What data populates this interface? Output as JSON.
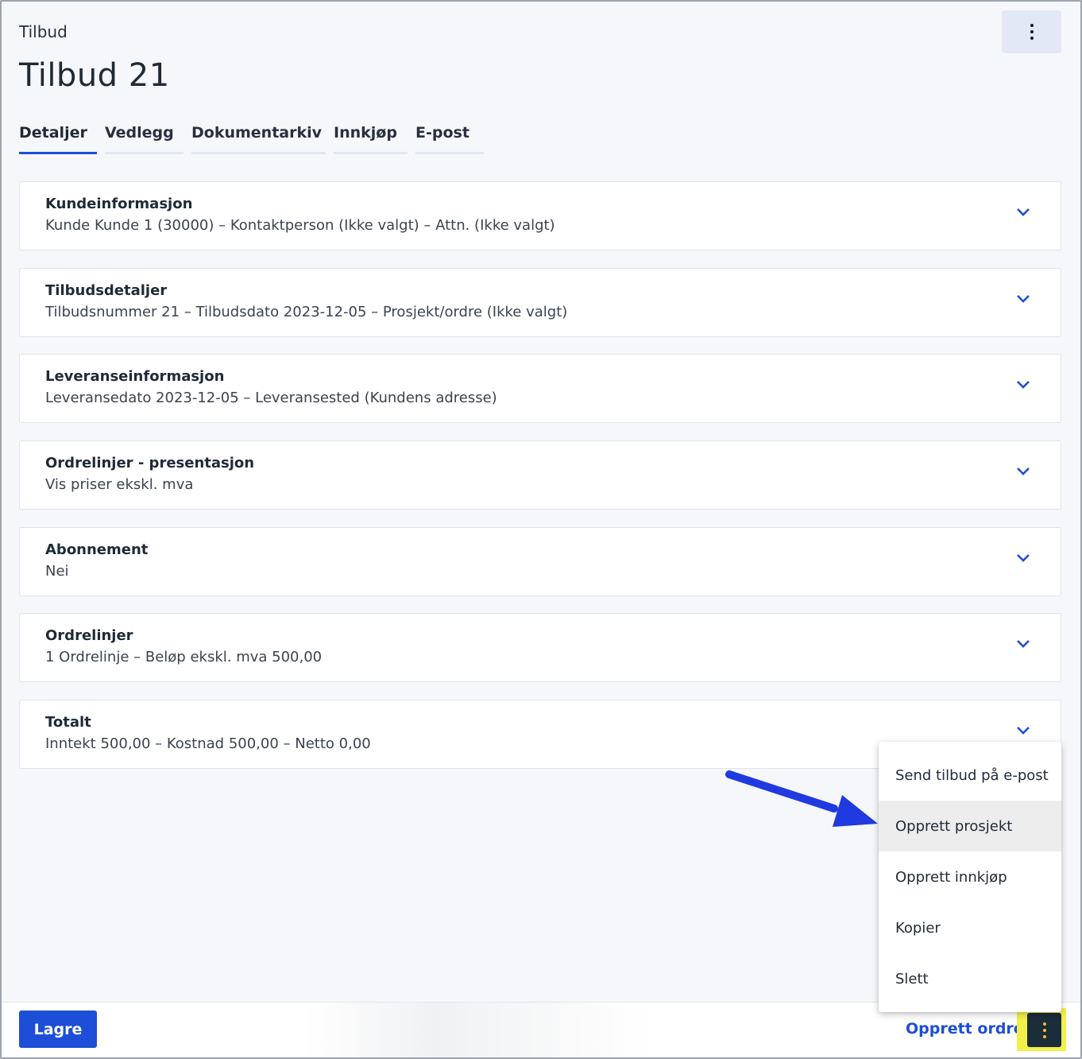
{
  "header": {
    "breadcrumb": "Tilbud",
    "title": "Tilbud 21"
  },
  "tabs": [
    {
      "label": "Detaljer",
      "active": true
    },
    {
      "label": "Vedlegg",
      "active": false
    },
    {
      "label": "Dokumentarkiv",
      "active": false
    },
    {
      "label": "Innkjøp",
      "active": false
    },
    {
      "label": "E-post",
      "active": false
    }
  ],
  "sections": [
    {
      "title": "Kundeinformasjon",
      "summary": "Kunde Kunde 1 (30000)  –  Kontaktperson (Ikke valgt)  –  Attn. (Ikke valgt)"
    },
    {
      "title": "Tilbudsdetaljer",
      "summary": "Tilbudsnummer 21  –  Tilbudsdato 2023-12-05  –  Prosjekt/ordre (Ikke valgt)"
    },
    {
      "title": "Leveranseinformasjon",
      "summary": "Leveransedato 2023-12-05  –  Leveransested (Kundens adresse)"
    },
    {
      "title": "Ordrelinjer - presentasjon",
      "summary": "Vis priser ekskl. mva"
    },
    {
      "title": "Abonnement",
      "summary": "Nei"
    },
    {
      "title": "Ordrelinjer",
      "summary": "1 Ordrelinje  –  Beløp ekskl. mva 500,00"
    },
    {
      "title": "Totalt",
      "summary": "Inntekt 500,00  –  Kostnad 500,00  –  Netto 0,00"
    }
  ],
  "menu": {
    "items": [
      {
        "label": "Send tilbud på e-post"
      },
      {
        "label": "Opprett prosjekt",
        "hovered": true
      },
      {
        "label": "Opprett innkjøp"
      },
      {
        "label": "Kopier"
      },
      {
        "label": "Slett"
      }
    ]
  },
  "footer": {
    "save_label": "Lagre",
    "create_order_label": "Opprett ordre"
  },
  "icons": {
    "more": "kebab-vertical-icon",
    "expand": "chevron-down-icon",
    "annotation": "arrow-icon"
  },
  "colors": {
    "accent": "#1d4ed8",
    "annotation_arrow": "#1f3ae0",
    "highlight": "#f3ef4a",
    "dark_button": "#1b2c3b"
  }
}
